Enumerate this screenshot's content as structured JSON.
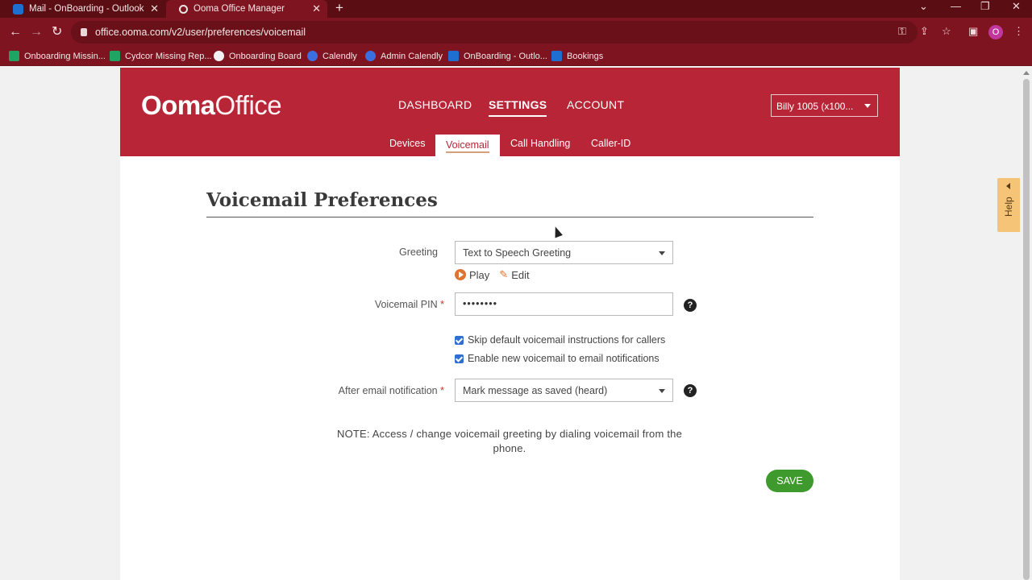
{
  "browser": {
    "tabs": [
      {
        "title": "Mail - OnBoarding - Outlook"
      },
      {
        "title": "Ooma Office Manager"
      }
    ],
    "url": "office.ooma.com/v2/user/preferences/voicemail",
    "profile_initial": "O",
    "bookmarks": [
      {
        "label": "Onboarding Missin...",
        "color": "#1fa463"
      },
      {
        "label": "Cydcor Missing Rep...",
        "color": "#1fa463"
      },
      {
        "label": "Onboarding Board",
        "color": "#f2f2f2"
      },
      {
        "label": "Calendly",
        "color": "#3b6fe0"
      },
      {
        "label": "Admin Calendly",
        "color": "#3b6fe0"
      },
      {
        "label": "OnBoarding - Outlo...",
        "color": "#1e6fd0"
      },
      {
        "label": "Bookings",
        "color": "#1e6fd0"
      }
    ]
  },
  "app": {
    "logo_bold": "Ooma",
    "logo_light": "Office",
    "nav": [
      {
        "label": "DASHBOARD",
        "active": false
      },
      {
        "label": "SETTINGS",
        "active": true
      },
      {
        "label": "ACCOUNT",
        "active": false
      }
    ],
    "user_select": "Billy 1005 (x100...",
    "subnav": [
      {
        "label": "Devices",
        "active": false
      },
      {
        "label": "Voicemail",
        "active": true
      },
      {
        "label": "Call Handling",
        "active": false
      },
      {
        "label": "Caller-ID",
        "active": false
      }
    ]
  },
  "form": {
    "title": "Voicemail Preferences",
    "greeting_label": "Greeting",
    "greeting_value": "Text to Speech Greeting",
    "play_label": "Play",
    "edit_label": "Edit",
    "pin_label": "Voicemail PIN",
    "pin_value": "••••••••",
    "required_mark": "*",
    "help_glyph": "?",
    "checkboxes": [
      {
        "label": "Skip default voicemail instructions for callers",
        "checked": true
      },
      {
        "label": "Enable new voicemail to email notifications",
        "checked": true
      }
    ],
    "after_email_label": "After email notification",
    "after_email_value": "Mark message as saved (heard)",
    "note": "NOTE: Access / change voicemail greeting by dialing voicemail from the phone.",
    "save_label": "SAVE"
  },
  "help_tab_label": "Help",
  "colors": {
    "brand": "#b72536",
    "save": "#3e9a2c",
    "accent": "#e0742f"
  }
}
